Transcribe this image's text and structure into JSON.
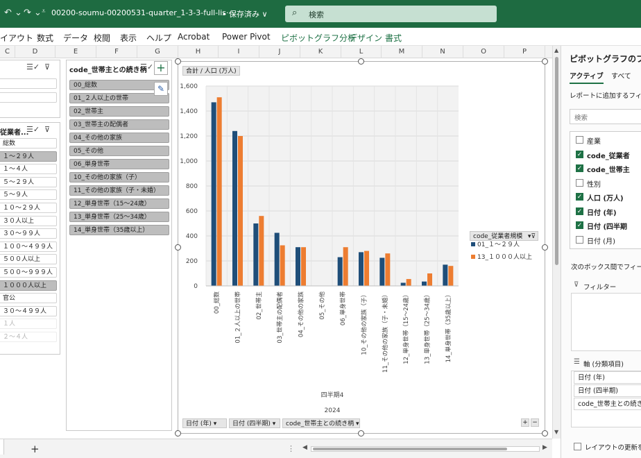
{
  "titlebar": {
    "filename": "00200-soumu-00200531-quarter_1-3-3-full-lis···",
    "saved": "• 保存済み ∨",
    "search_placeholder": "検索"
  },
  "menu": [
    {
      "label": "イアウト",
      "contextual": false
    },
    {
      "label": "数式",
      "contextual": false
    },
    {
      "label": "データ",
      "contextual": false
    },
    {
      "label": "校閲",
      "contextual": false
    },
    {
      "label": "表示",
      "contextual": false
    },
    {
      "label": "ヘルプ",
      "contextual": false
    },
    {
      "label": "Acrobat",
      "contextual": false
    },
    {
      "label": "Power Pivot",
      "contextual": false
    },
    {
      "label": "ピボットグラフ分析",
      "contextual": true
    },
    {
      "label": "デザイン",
      "contextual": true
    },
    {
      "label": "書式",
      "contextual": true
    }
  ],
  "columns": [
    "C",
    "D",
    "E",
    "F",
    "G",
    "H",
    "I",
    "J",
    "K",
    "L",
    "M",
    "N",
    "O",
    "P"
  ],
  "slicer_left_top": {
    "items": [
      {
        "label": "",
        "state": "un"
      },
      {
        "label": "",
        "state": "un"
      }
    ]
  },
  "slicer_left": {
    "title": "従業者...",
    "items": [
      {
        "label": "総数",
        "state": "un"
      },
      {
        "label": "１～２９人",
        "state": "sel"
      },
      {
        "label": "１～４人",
        "state": "un"
      },
      {
        "label": "５～２９人",
        "state": "un"
      },
      {
        "label": "５～９人",
        "state": "un"
      },
      {
        "label": "１０～２９人",
        "state": "un"
      },
      {
        "label": "３０人以上",
        "state": "un"
      },
      {
        "label": "３０～９９人",
        "state": "un"
      },
      {
        "label": "１００～４９９人",
        "state": "un"
      },
      {
        "label": "５００人以上",
        "state": "un"
      },
      {
        "label": "５００～９９９人",
        "state": "un"
      },
      {
        "label": "１０００人以上",
        "state": "sel"
      },
      {
        "label": "官公",
        "state": "un"
      },
      {
        "label": "３０～４９９人",
        "state": "un"
      },
      {
        "label": "１人",
        "state": "dim"
      },
      {
        "label": "２～４人",
        "state": "dim"
      }
    ]
  },
  "slicer_mid": {
    "title": "code_世帯主との続き柄",
    "items": [
      "00_総数",
      "01_２人以上の世帯",
      "02_世帯主",
      "03_世帯主の配偶者",
      "04_その他の家族",
      "05_その他",
      "06_単身世帯",
      "10_その他の家族（子）",
      "11_その他の家族（子・未婚）",
      "12_単身世帯（15～24歳）",
      "13_単身世帯（25～34歳）",
      "14_単身世帯（35歳以上）"
    ]
  },
  "chart_data": {
    "type": "bar",
    "value_field": "合計 / 人口 (万人)",
    "categories": [
      "00_総数",
      "01_２人以上の世帯",
      "02_世帯主",
      "03_世帯主の配偶者",
      "04_その他の家族",
      "05_その他",
      "06_単身世帯",
      "10_その他の家族（子）",
      "11_その他の家族（子・未婚）",
      "12_単身世帯（15～24歳）",
      "13_単身世帯（25～34歳）",
      "14_単身世帯（35歳以上）"
    ],
    "series": [
      {
        "name": "01_１～２９人",
        "color": "#1f4e79",
        "values": [
          1470,
          1240,
          500,
          425,
          310,
          null,
          230,
          270,
          225,
          25,
          35,
          170
        ]
      },
      {
        "name": "13_１０００人以上",
        "color": "#ed7d31",
        "values": [
          1510,
          1200,
          560,
          325,
          310,
          null,
          310,
          280,
          260,
          55,
          100,
          160
        ]
      }
    ],
    "ylim": [
      0,
      1600
    ],
    "yticks": [
      0,
      200,
      400,
      600,
      800,
      1000,
      1200,
      1400,
      1600
    ],
    "ytick_labels": [
      "0",
      "200",
      "400",
      "600",
      "800",
      "1,000",
      "1,200",
      "1,400",
      "1,600"
    ],
    "group_labels": [
      "四半期4",
      "2024"
    ],
    "legend_field": "code_従業者規模",
    "legend_position": "right",
    "grid": true
  },
  "chart_buttons": [
    "日付 (年)",
    "日付 (四半期)",
    "code_世帯主との続き柄"
  ],
  "status": {
    "add_sheet": "+"
  },
  "pane": {
    "title": "ピボットグラフのフィー",
    "tabs": [
      "アクティブ",
      "すべて"
    ],
    "subtitle": "レポートに追加するフィール",
    "search_placeholder": "検索",
    "fields": [
      {
        "label": "産業",
        "checked": false,
        "bold": false
      },
      {
        "label": "code_従業者",
        "checked": true,
        "bold": true
      },
      {
        "label": "code_世帯主",
        "checked": true,
        "bold": true
      },
      {
        "label": "性別",
        "checked": false,
        "bold": false
      },
      {
        "label": "人口 (万人)",
        "checked": true,
        "bold": true
      },
      {
        "label": "日付 (年)",
        "checked": true,
        "bold": true
      },
      {
        "label": "日付 (四半期",
        "checked": true,
        "bold": true
      },
      {
        "label": "日付 (月)",
        "checked": false,
        "bold": false
      }
    ],
    "drag_hint": "次のボックス間でフィールド",
    "filter_label": "フィルター",
    "axis_label": "軸 (分類項目)",
    "axis_items": [
      "日付 (年)",
      "日付 (四半期)",
      "code_世帯主との続き柄"
    ],
    "defer_label": "レイアウトの更新を保"
  }
}
